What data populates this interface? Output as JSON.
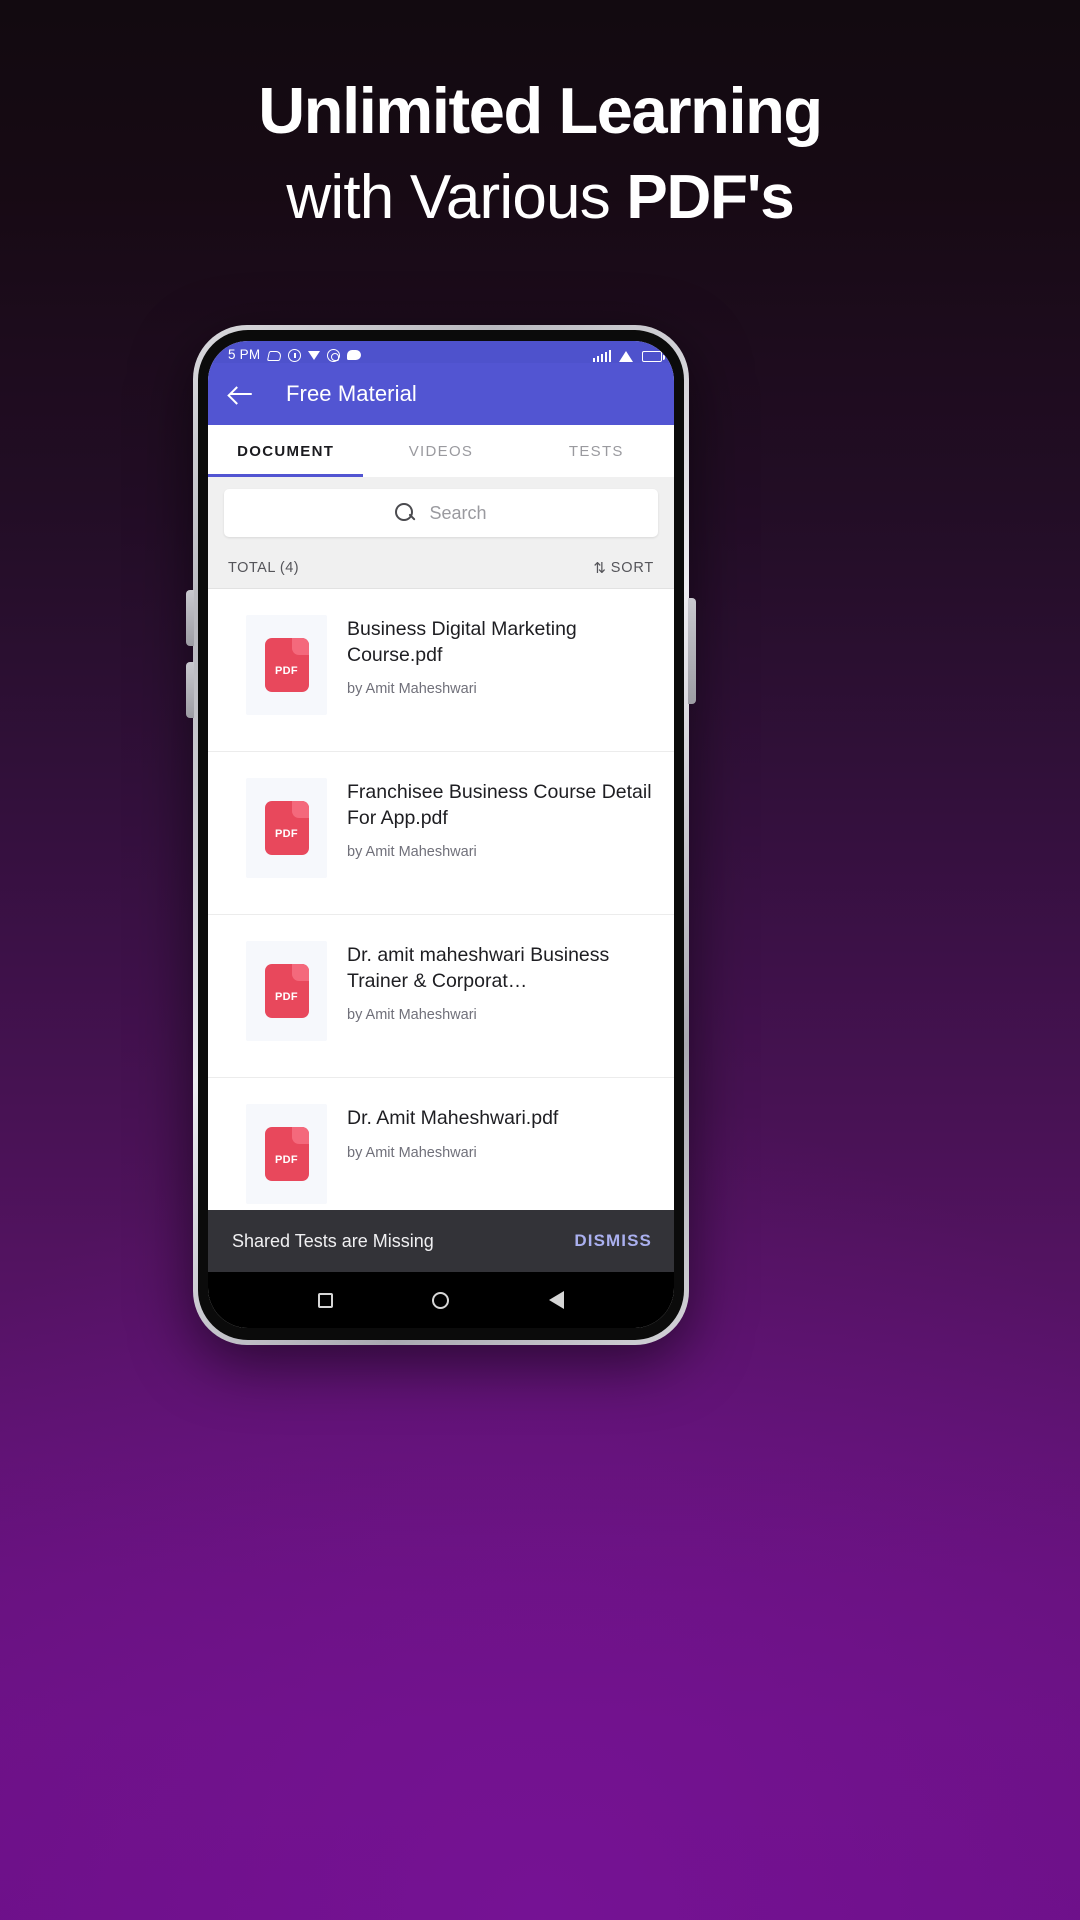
{
  "promo": {
    "line1": "Unlimited Learning",
    "line2_light": "with Various ",
    "line2_bold": "PDF's"
  },
  "statusbar": {
    "time": "5 PM",
    "icons_left": [
      "silent-icon",
      "alarm-icon",
      "download-icon",
      "whatsapp-icon",
      "chat-icon"
    ],
    "icons_right": [
      "signal-icon",
      "wifi-icon",
      "battery-icon"
    ]
  },
  "appbar": {
    "back_icon": "back-arrow-icon",
    "title": "Free Material"
  },
  "tabs": [
    {
      "label": "DOCUMENT",
      "active": true
    },
    {
      "label": "VIDEOS",
      "active": false
    },
    {
      "label": "TESTS",
      "active": false
    }
  ],
  "search": {
    "placeholder": "Search",
    "icon": "search-icon"
  },
  "listheader": {
    "total": "TOTAL (4)",
    "sort_icon": "⇅",
    "sort_label": "SORT"
  },
  "documents": [
    {
      "title": "Business Digital Marketing Course.pdf",
      "author": "by Amit Maheshwari",
      "type": "PDF"
    },
    {
      "title": "Franchisee Business Course Detail For App.pdf",
      "author": "by Amit Maheshwari",
      "type": "PDF"
    },
    {
      "title": "Dr. amit maheshwari Business Trainer & Corporat…",
      "author": "by Amit Maheshwari",
      "type": "PDF"
    },
    {
      "title": "Dr. Amit Maheshwari.pdf",
      "author": "by Amit Maheshwari",
      "type": "PDF"
    }
  ],
  "snackbar": {
    "message": "Shared Tests are Missing",
    "action": "DISMISS"
  },
  "navbar": {
    "recents": "square-icon",
    "home": "circle-icon",
    "back": "triangle-icon"
  },
  "colors": {
    "appbar": "#5255d2",
    "tab_indicator": "#5255d2",
    "pdf_red": "#e8485c",
    "snackbar_bg": "#333338",
    "snackbar_action": "#aab0ef"
  }
}
